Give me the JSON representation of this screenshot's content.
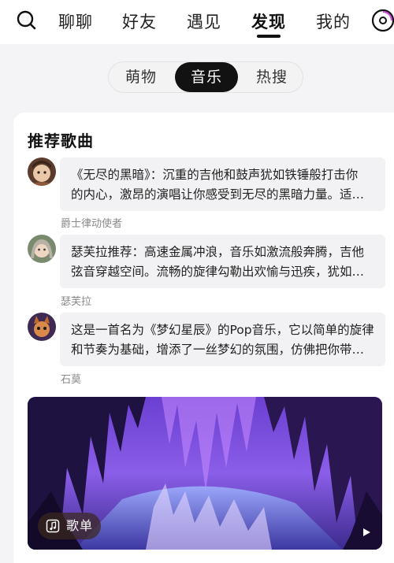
{
  "nav": {
    "tabs": [
      {
        "label": "聊聊"
      },
      {
        "label": "好友"
      },
      {
        "label": "遇见"
      },
      {
        "label": "发现"
      },
      {
        "label": "我的"
      }
    ],
    "active": "发现"
  },
  "segment": {
    "items": [
      {
        "label": "萌物"
      },
      {
        "label": "音乐"
      },
      {
        "label": "热搜"
      }
    ],
    "active": "音乐"
  },
  "section": {
    "title": "推荐歌曲"
  },
  "comments": [
    {
      "lines": [
        "《无尽的黑暗》：沉重的吉他和鼓声犹如铁锤般打击你",
        "的内心，激昂的演唱让你感受到无尽的黑暗力量。适…"
      ],
      "author": "爵士律动使者"
    },
    {
      "lines": [
        "瑟芙拉推荐：高速金属冲浪，音乐如激流般奔腾，吉他",
        "弦音穿越空间。流畅的旋律勾勒出欢愉与迅疾，犹如…"
      ],
      "author": "瑟芙拉"
    },
    {
      "lines": [
        "这是一首名为《梦幻星辰》的Pop音乐，它以简单的旋律",
        "和节奏为基础，增添了一丝梦幻的氛围，仿佛把你带…"
      ],
      "author": "石莫"
    }
  ],
  "banner": {
    "chip_label": "歌单"
  },
  "colors": {
    "accent": "#121212",
    "bubble": "#f2f2f4",
    "author": "#8a8a8a"
  }
}
